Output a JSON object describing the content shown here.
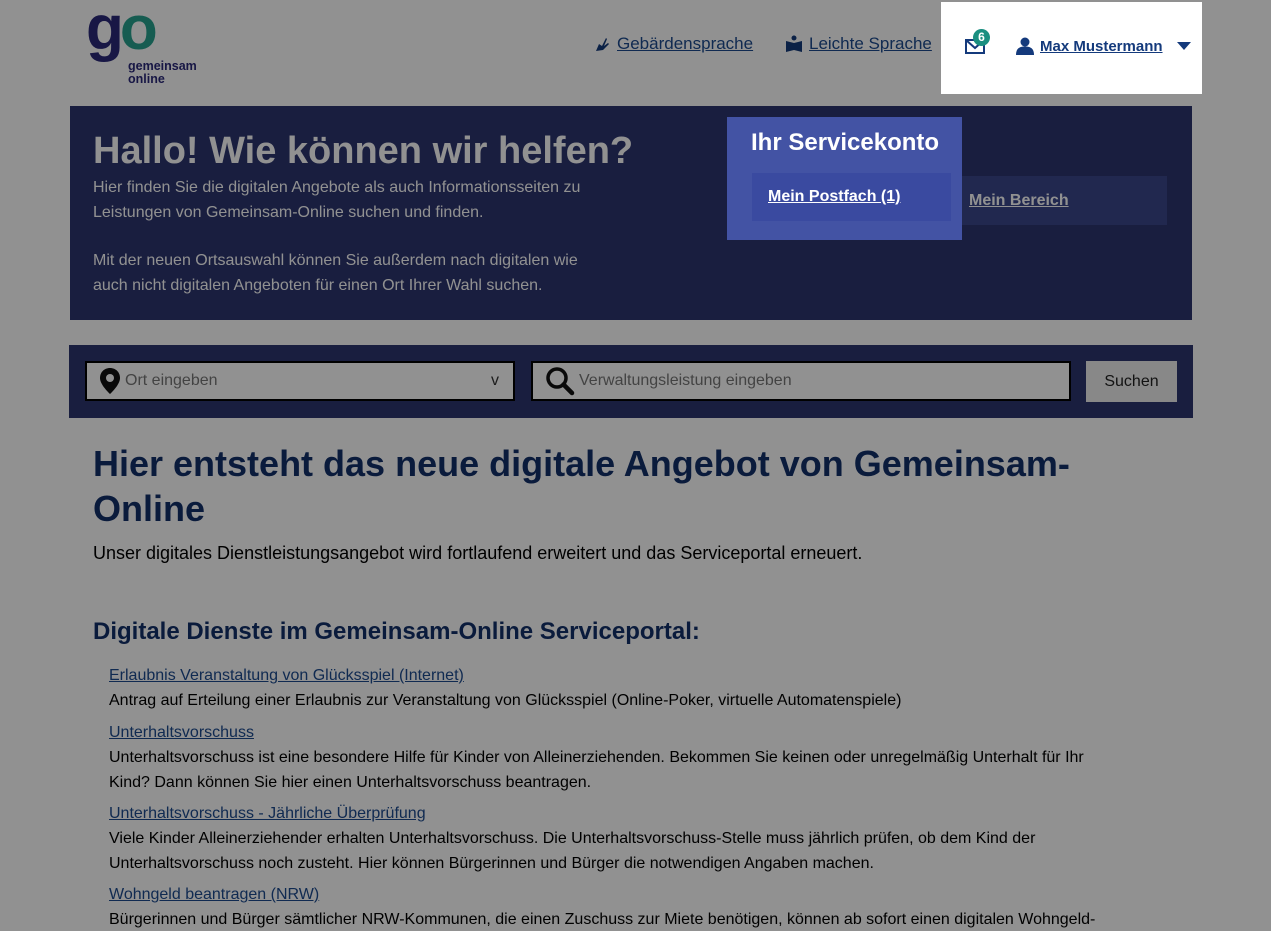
{
  "header": {
    "logo": {
      "text": "go",
      "sub_line1": "gemeinsam",
      "sub_line2": "online"
    },
    "links": [
      {
        "label": "Gebärdensprache",
        "icon": "sign-language-icon"
      },
      {
        "label": "Leichte Sprache",
        "icon": "book-icon"
      }
    ],
    "mail_count": "6",
    "user_name": "Max Mustermann"
  },
  "hero": {
    "title": "Hallo! Wie können wir helfen?",
    "text1": "Hier finden Sie die digitalen Angebote als auch Informationsseiten zu Leistungen von Gemeinsam-Online suchen und finden.",
    "text2": "Mit der neuen Ortsauswahl können Sie außerdem nach digitalen wie auch nicht digitalen Angeboten für einen Ort Ihrer Wahl suchen.",
    "servicekonto": {
      "title": "Ihr Servicekonto",
      "postfach": "Mein Postfach (1)",
      "bereich": "Mein Bereich"
    }
  },
  "search": {
    "ort_placeholder": "Ort eingeben",
    "ort_chevron": "v",
    "leistung_placeholder": "Verwaltungsleistung eingeben",
    "button": "Suchen"
  },
  "main": {
    "title": "Hier entsteht das neue digitale Angebot von Gemeinsam-Online",
    "intro": "Unser digitales Dienstleistungsangebot wird fortlaufend erweitert und das Serviceportal erneuert.",
    "section_title": "Digitale Dienste im Gemeinsam-Online Serviceportal:",
    "services": [
      {
        "title": "Erlaubnis Veranstaltung von Glücksspiel (Internet)",
        "desc": "Antrag auf Erteilung einer Erlaubnis zur Veranstaltung von Glücksspiel (Online-Poker, virtuelle Automatenspiele)"
      },
      {
        "title": "Unterhaltsvorschuss",
        "desc": "Unterhaltsvorschuss ist eine besondere Hilfe für Kinder von Alleinerziehenden. Bekommen Sie keinen oder unregelmäßig Unterhalt für Ihr Kind? Dann können Sie hier einen Unterhaltsvorschuss beantragen."
      },
      {
        "title": "Unterhaltsvorschuss - Jährliche Überprüfung",
        "desc": "Viele Kinder Alleinerziehender erhalten Unterhaltsvorschuss. Die Unterhaltsvorschuss-Stelle muss jährlich prüfen, ob dem Kind der Unterhaltsvorschuss noch zusteht. Hier können Bürgerinnen und Bürger die notwendigen Angaben machen."
      },
      {
        "title": "Wohngeld beantragen (NRW)",
        "desc": "Bürgerinnen und Bürger sämtlicher NRW-Kommunen, die einen Zuschuss zur Miete benötigen, können ab sofort einen digitalen Wohngeld-"
      }
    ]
  },
  "colors": {
    "navy": "#2d3570",
    "servicekonto": "#4353a4",
    "link": "#1d4b8f",
    "badge": "#1a8f80"
  }
}
